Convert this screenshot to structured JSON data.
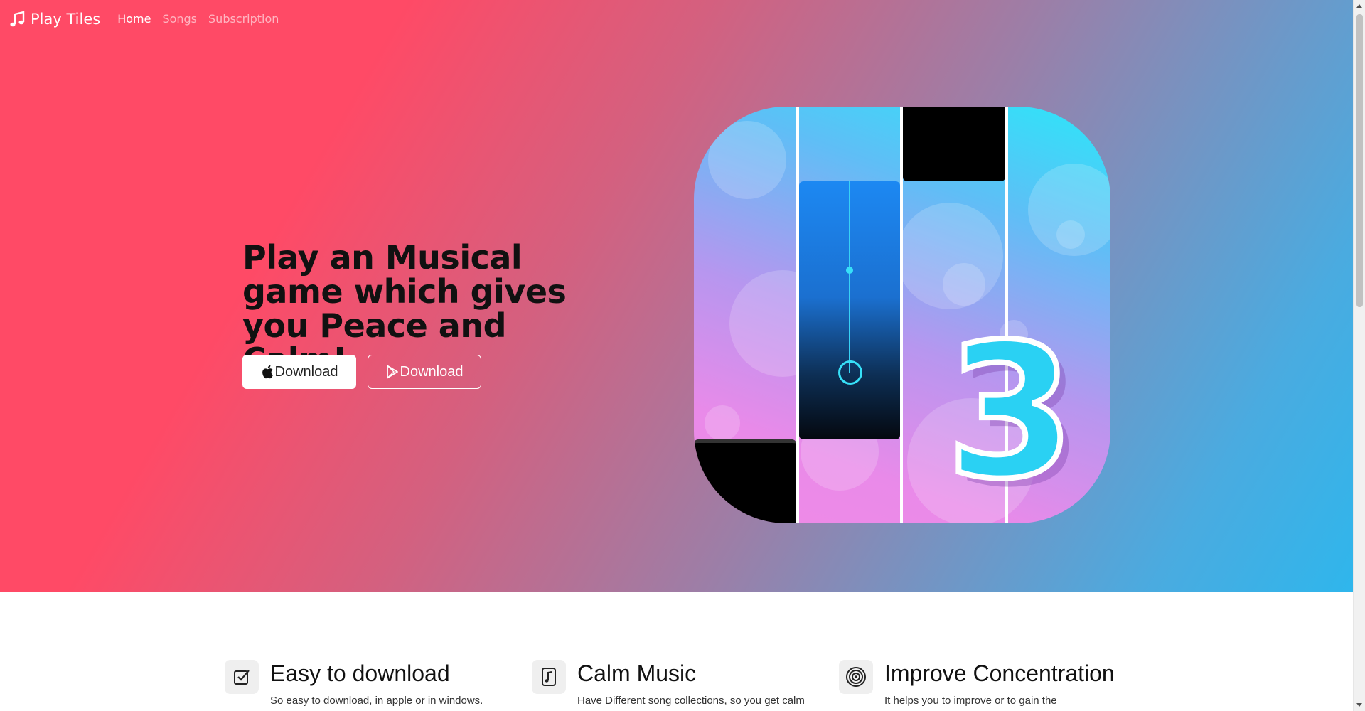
{
  "nav": {
    "brand": "Play Tiles",
    "brand_icon": "music-note-icon",
    "links": [
      {
        "label": "Home",
        "active": true
      },
      {
        "label": "Songs",
        "active": false
      },
      {
        "label": "Subscription",
        "active": false
      }
    ]
  },
  "hero": {
    "title": "Play an Musical game which gives you Peace and Calm!",
    "buttons": [
      {
        "label": "Download",
        "icon": "apple-icon",
        "style": "light"
      },
      {
        "label": "Download",
        "icon": "google-play-icon",
        "style": "outline"
      }
    ],
    "image": {
      "name": "piano-tiles-3-app-icon",
      "number": "3"
    },
    "colors": {
      "gradient_start": "#ff4a66",
      "gradient_end": "#2fb6ec"
    }
  },
  "features": [
    {
      "icon": "check-square-icon",
      "title": "Easy to download",
      "description": "So easy to download, in apple or in windows."
    },
    {
      "icon": "music-file-icon",
      "title": "Calm Music",
      "description": "Have Different song collections, so you get calm"
    },
    {
      "icon": "target-icon",
      "title": "Improve Concentration",
      "description": "It helps you to improve or to gain the"
    }
  ]
}
